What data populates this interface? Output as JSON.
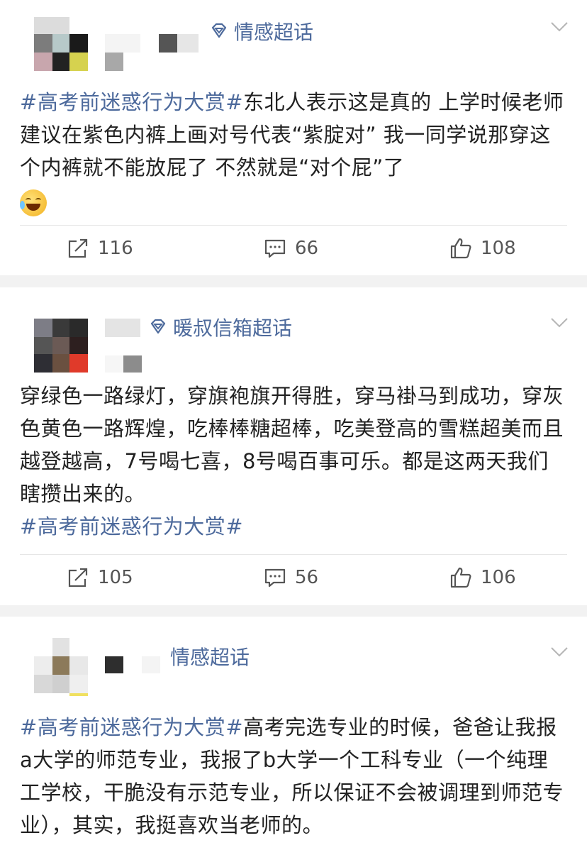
{
  "posts": [
    {
      "topic": "情感超话",
      "text_tag": "#高考前迷惑行为大赏#",
      "text": "东北人表示这是真的 上学时候老师建议在紫色内裤上画对号代表“紫腚对” 我一同学说那穿这个内裤就不能放屁了 不然就是“对个屁”了",
      "emoji_icon": "laughing-crying-emoji",
      "reposts": "116",
      "comments": "66",
      "likes": "108"
    },
    {
      "topic": "暖叔信箱超话",
      "text": "穿绿色一路绿灯，穿旗袍旗开得胜，穿马褂马到成功，穿灰色黄色一路辉煌，吃棒棒糖超棒，吃美登高的雪糕超美而且越登越高，7号喝七喜，8号喝百事可乐。都是这两天我们瞎攒出来的。",
      "text_tag": "#高考前迷惑行为大赏#",
      "reposts": "105",
      "comments": "56",
      "likes": "106"
    },
    {
      "topic": "情感超话",
      "text_tag": "#高考前迷惑行为大赏#",
      "text": "高考完选专业的时候，爸爸让我报a大学的师范专业，我报了b大学一个工科专业（一个纯理工学校，干脆没有示范专业，所以保证不会被调理到师范专业），其实，我挺喜欢当老师的。"
    }
  ],
  "colors": {
    "link": "#4d6a9c",
    "background": "#f2f2f2",
    "card": "#ffffff"
  },
  "icons": [
    "super-topic-gem-icon",
    "chevron-down-icon",
    "repost-icon",
    "comment-icon",
    "like-icon"
  ]
}
